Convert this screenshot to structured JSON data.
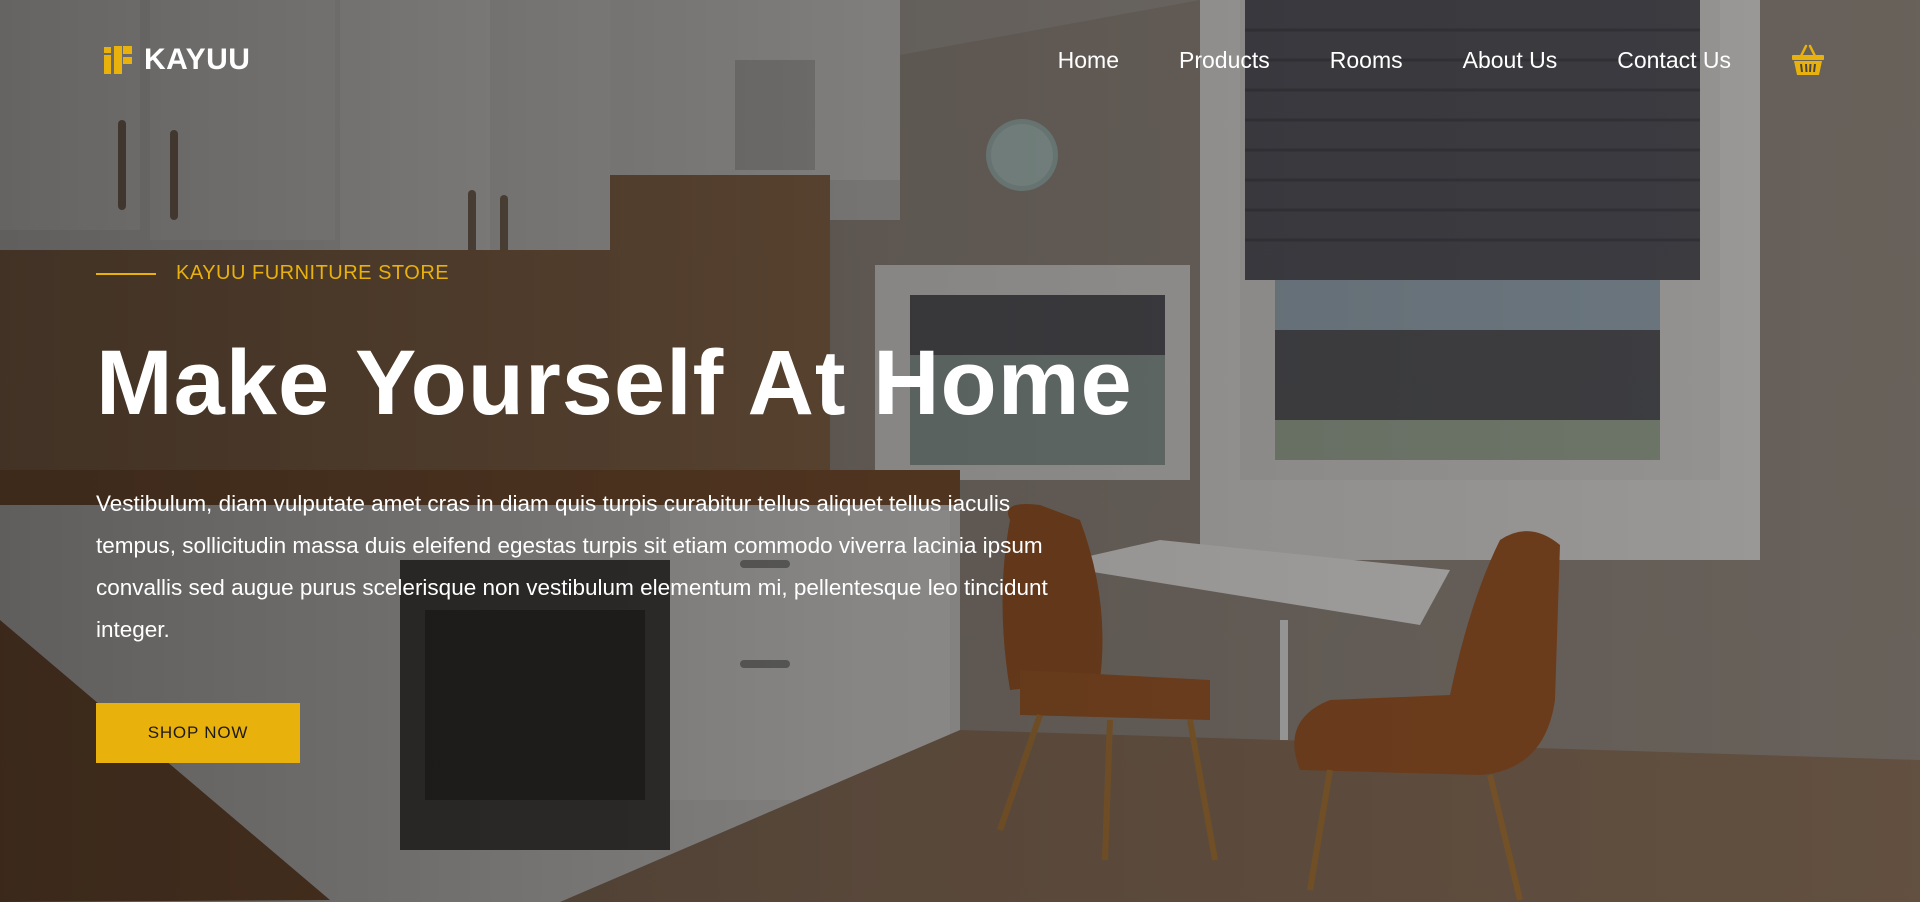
{
  "brand": {
    "name": "KAYUU",
    "logo_icon": "kayuu-logo-icon"
  },
  "nav": {
    "links": [
      "Home",
      "Products",
      "Rooms",
      "About Us",
      "Contact Us"
    ],
    "cart_icon": "shopping-basket-icon"
  },
  "hero": {
    "eyebrow": "KAYUU FURNITURE STORE",
    "headline": "Make Yourself At Home",
    "body": "Vestibulum, diam vulputate amet cras in diam quis turpis curabitur tellus aliquet tellus iaculis tempus, sollicitudin massa duis eleifend egestas turpis sit etiam commodo viverra lacinia ipsum convallis sed augue purus scelerisque non vestibulum elementum mi, pellentesque leo tincidunt integer.",
    "cta_label": "SHOP NOW",
    "background_image": "kitchen-dining-interior-photo"
  },
  "colors": {
    "accent": "#e9b10c",
    "text": "#ffffff"
  }
}
